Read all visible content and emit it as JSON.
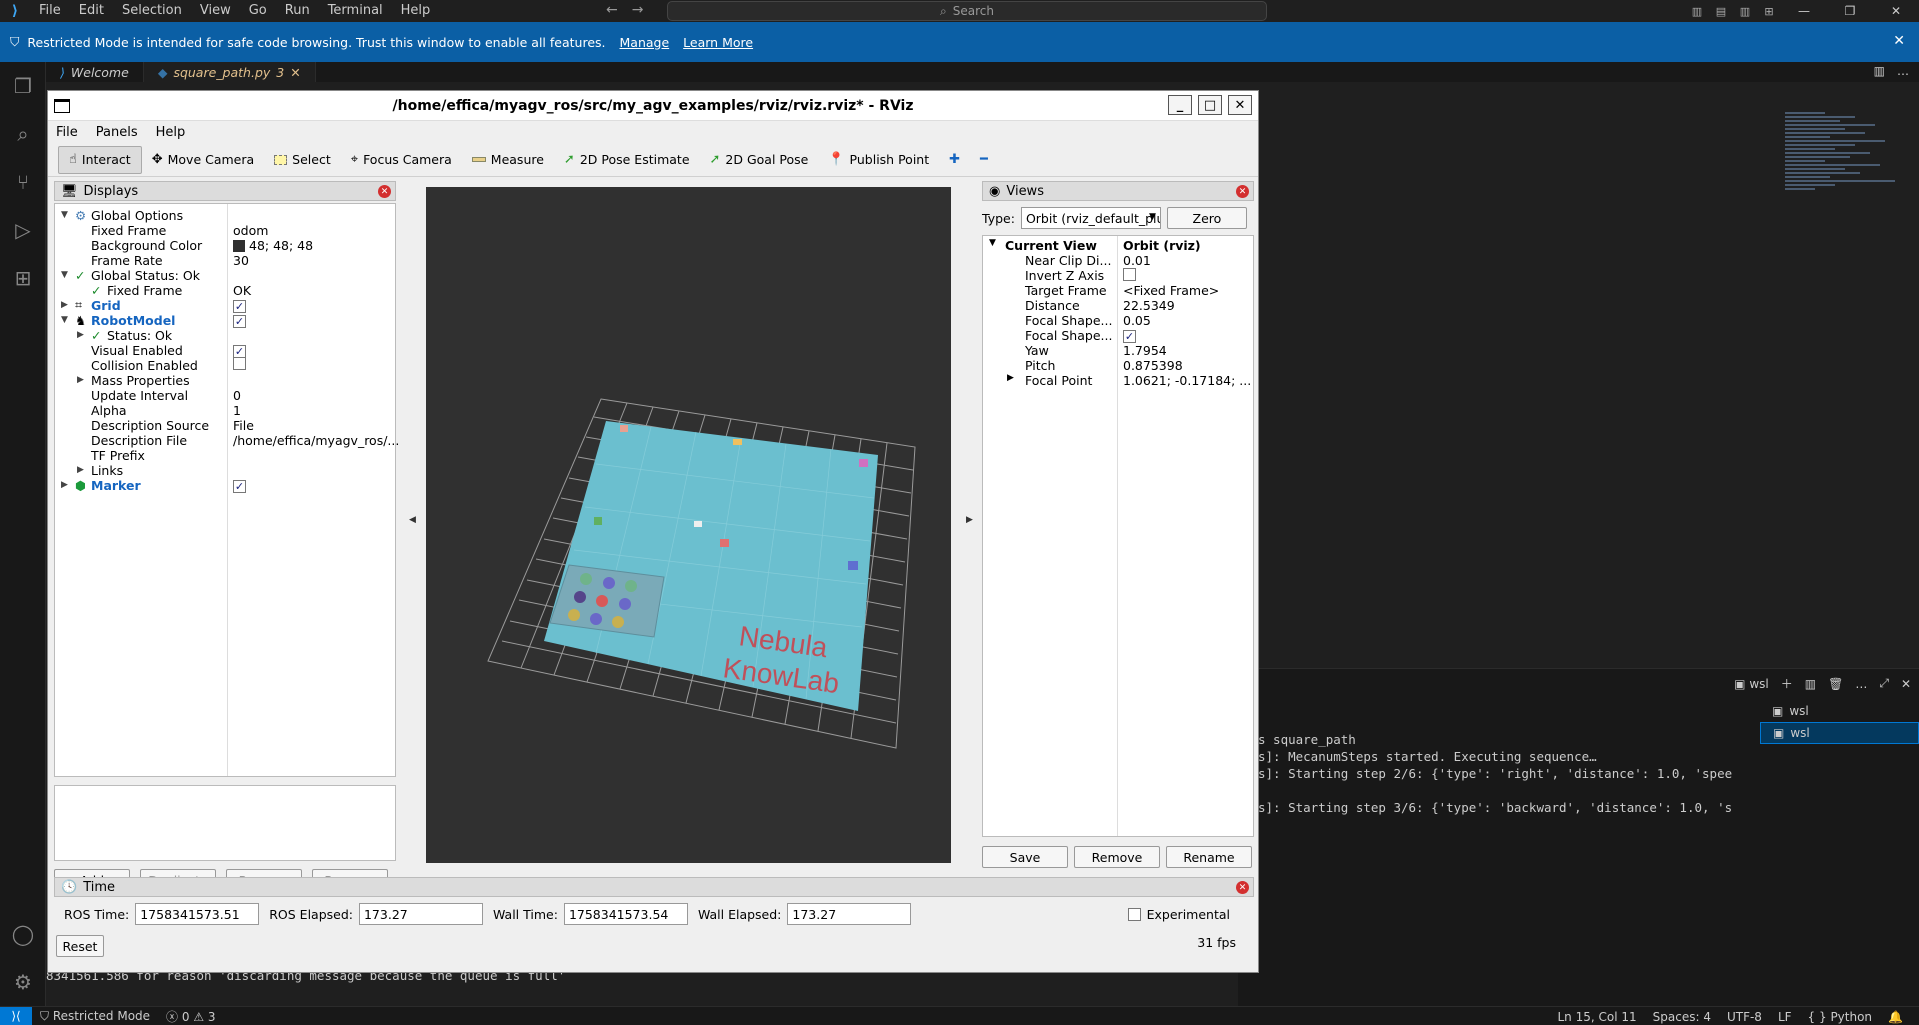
{
  "vscode": {
    "menus": [
      "File",
      "Edit",
      "Selection",
      "View",
      "Go",
      "Run",
      "Terminal",
      "Help"
    ],
    "search_placeholder": "Search",
    "restricted_message": "Restricted Mode is intended for safe code browsing. Trust this window to enable all features.",
    "restricted_links": [
      "Manage",
      "Learn More"
    ],
    "tabs": [
      {
        "label": "Welcome",
        "active": false
      },
      {
        "label": "square_path.py",
        "badge": "3",
        "active": true
      }
    ],
    "terminal": {
      "tab_label": "wsl",
      "sessions": [
        "wsl",
        "wsl"
      ],
      "lines": [
        "s square_path",
        "s]: MecanumSteps started. Executing sequence…",
        "s]: Starting step 2/6: {'type': 'right', 'distance': 1.0, 'spee",
        "s]: Starting step 3/6: {'type': 'backward', 'distance': 1.0, 's"
      ],
      "bottom_line": "8341561.586 for reason 'discarding message because the queue is full'"
    },
    "status": {
      "restricted": "Restricted Mode",
      "problems": "0",
      "warnings": "3",
      "cursor": "Ln 15, Col 11",
      "spaces": "Spaces: 4",
      "encoding": "UTF-8",
      "eol": "LF",
      "language": "Python"
    }
  },
  "rviz": {
    "title": "/home/effica/myagv_ros/src/my_agv_examples/rviz/rviz.rviz* - RViz",
    "menus": [
      "File",
      "Panels",
      "Help"
    ],
    "tools": [
      "Interact",
      "Move Camera",
      "Select",
      "Focus Camera",
      "Measure",
      "2D Pose Estimate",
      "2D Goal Pose",
      "Publish Point"
    ],
    "displays": {
      "title": "Displays",
      "rows": {
        "global_options": "Global Options",
        "fixed_frame_label": "Fixed Frame",
        "fixed_frame_value": "odom",
        "bg_color_label": "Background Color",
        "bg_color_value": "48; 48; 48",
        "frame_rate_label": "Frame Rate",
        "frame_rate_value": "30",
        "global_status": "Global Status: Ok",
        "gs_fixed_frame_label": "Fixed Frame",
        "gs_fixed_frame_value": "OK",
        "grid": "Grid",
        "robot_model": "RobotModel",
        "status_ok": "Status: Ok",
        "visual_enabled": "Visual Enabled",
        "collision_enabled": "Collision Enabled",
        "mass_properties": "Mass Properties",
        "update_interval_label": "Update Interval",
        "update_interval_value": "0",
        "alpha_label": "Alpha",
        "alpha_value": "1",
        "desc_source_label": "Description Source",
        "desc_source_value": "File",
        "desc_file_label": "Description File",
        "desc_file_value": "/home/effica/myagv_ros/...",
        "tf_prefix": "TF Prefix",
        "links": "Links",
        "marker": "Marker"
      },
      "buttons": [
        "Add",
        "Duplicate",
        "Remove",
        "Rename"
      ]
    },
    "viewport": {
      "background_color": "#303030",
      "map_color": "#6bbfcf",
      "text_line1": "Nebula",
      "text_line2": "KnowLab"
    },
    "views": {
      "title": "Views",
      "type_label": "Type:",
      "type_value": "Orbit (rviz_default_plugins)",
      "zero_button": "Zero",
      "current_view_label": "Current View",
      "current_view_value": "Orbit (rviz)",
      "props": [
        {
          "label": "Near Clip Di...",
          "value": "0.01"
        },
        {
          "label": "Invert Z Axis",
          "value": ""
        },
        {
          "label": "Target Frame",
          "value": "<Fixed Frame>"
        },
        {
          "label": "Distance",
          "value": "22.5349"
        },
        {
          "label": "Focal Shape...",
          "value": "0.05"
        },
        {
          "label": "Focal Shape...",
          "value": ""
        },
        {
          "label": "Yaw",
          "value": "1.7954"
        },
        {
          "label": "Pitch",
          "value": "0.875398"
        },
        {
          "label": "Focal Point",
          "value": "1.0621; -0.17184; ..."
        }
      ],
      "buttons": [
        "Save",
        "Remove",
        "Rename"
      ]
    },
    "time": {
      "title": "Time",
      "ros_time_label": "ROS Time:",
      "ros_time": "1758341573.51",
      "ros_elapsed_label": "ROS Elapsed:",
      "ros_elapsed": "173.27",
      "wall_time_label": "Wall Time:",
      "wall_time": "1758341573.54",
      "wall_elapsed_label": "Wall Elapsed:",
      "wall_elapsed": "173.27",
      "experimental_label": "Experimental",
      "reset_button": "Reset",
      "fps": "31 fps"
    }
  }
}
